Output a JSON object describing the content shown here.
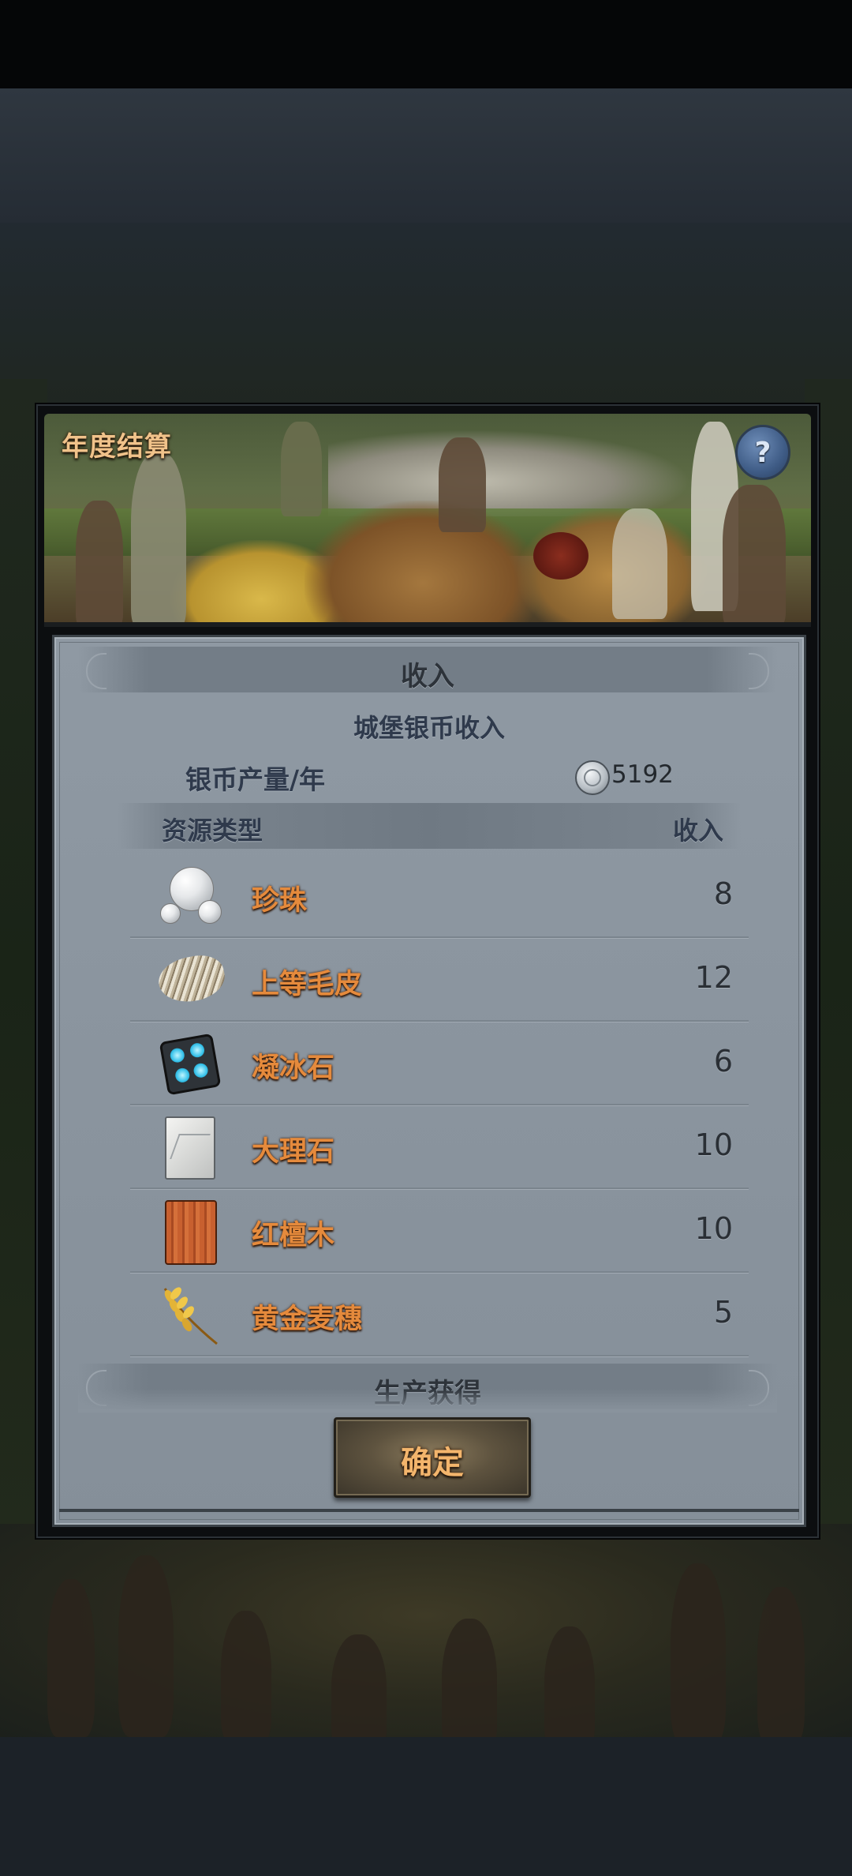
{
  "dialog": {
    "title": "年度结算",
    "help_icon": "question-mark-icon",
    "help_symbol": "?"
  },
  "income_section": {
    "title": "收入",
    "subheading": "城堡银币收入",
    "silver_production": {
      "label": "银币产量/年",
      "icon": "silver-coin-icon",
      "value": "5192"
    },
    "table": {
      "headers": {
        "type": "资源类型",
        "income": "收入"
      },
      "rows": [
        {
          "name": "珍珠",
          "icon": "pearl-icon",
          "value": "8"
        },
        {
          "name": "上等毛皮",
          "icon": "fur-icon",
          "value": "12"
        },
        {
          "name": "凝冰石",
          "icon": "ice-stone-icon",
          "value": "6"
        },
        {
          "name": "大理石",
          "icon": "marble-icon",
          "value": "10"
        },
        {
          "name": "红檀木",
          "icon": "red-sandalwood-icon",
          "value": "10"
        },
        {
          "name": "黄金麦穗",
          "icon": "golden-wheat-icon",
          "value": "5"
        }
      ]
    }
  },
  "production_section": {
    "title": "生产获得"
  },
  "confirm_button": {
    "label": "确定"
  },
  "colors": {
    "panel": "#8a949e",
    "resource_name": "#e58a3c",
    "title_text": "#f0c28a",
    "button_text": "#f3b56c"
  }
}
